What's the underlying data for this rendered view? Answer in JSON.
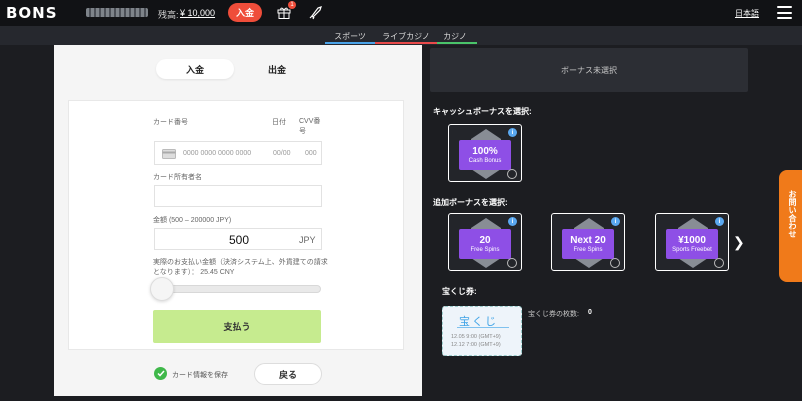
{
  "header": {
    "logo": "BONS",
    "balance_label": "残高:",
    "balance_value": "¥ 10,000",
    "deposit_label": "入金",
    "gift_badge": "1",
    "language": "日本語"
  },
  "categories": [
    {
      "label": "スポーツ",
      "color": "#4aa3e8"
    },
    {
      "label": "ライブカジノ",
      "color": "#e84a4a"
    },
    {
      "label": "カジノ",
      "color": "#4ac46a"
    }
  ],
  "tabs": {
    "deposit": "入金",
    "withdraw": "出金"
  },
  "form": {
    "card_number_label": "カード番号",
    "date_label": "日付",
    "cvv_label": "CVV番号",
    "card_number_placeholder": "0000 0000 0000 0000",
    "date_placeholder": "00/00",
    "cvv_placeholder": "000",
    "holder_label": "カード所有者名",
    "amount_label": "金額 (500 – 200000 JPY)",
    "amount_value": "500",
    "currency": "JPY",
    "actual_label_1": "実際のお支払い金額（決済システム上、外貨建ての請求",
    "actual_label_2": "となります）： 25.45 CNY",
    "slider_level": 0,
    "pay_label": "支払う",
    "save_card_label": "カード情報を保存",
    "back_label": "戻る"
  },
  "bonus": {
    "none_selected": "ボーナス未選択",
    "cash_section": "キャッシュボーナスを選択:",
    "cash_items": [
      {
        "big": "100%",
        "small": "Cash Bonus"
      }
    ],
    "extra_section": "追加ボーナスを選択:",
    "extra_items": [
      {
        "big": "20",
        "small": "Free Spins"
      },
      {
        "big": "Next 20",
        "small": "Free Spins"
      },
      {
        "big": "¥1000",
        "small": "Sports Freebet"
      }
    ],
    "info_glyph": "i"
  },
  "lottery": {
    "section": "宝くじ券:",
    "ticket_title": "宝くじ",
    "ticket_date_1": "12.05 9:00 (GMT+9)",
    "ticket_date_2": "12.12 7:00 (GMT+9)",
    "count_label": "宝くじ券の枚数:",
    "count_value": "0"
  },
  "contact": {
    "label": "お問い合わせ"
  }
}
